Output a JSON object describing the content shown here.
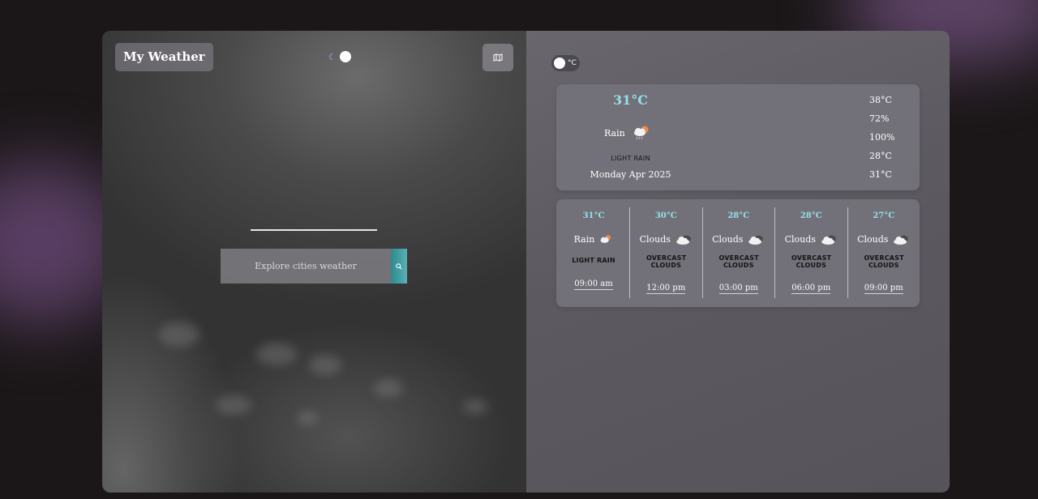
{
  "header": {
    "brand": "My Weather"
  },
  "search": {
    "placeholder": "Explore cities weather"
  },
  "unit_toggle": {
    "label": "°C"
  },
  "current": {
    "temp": "31°C",
    "condition": "Rain",
    "description": "LIGHT RAIN",
    "date": "Monday Apr 2025",
    "stats": [
      "38°C",
      "72%",
      "100%",
      "28°C",
      "31°C"
    ]
  },
  "forecast": [
    {
      "temp": "31°C",
      "condition": "Rain",
      "description": "LIGHT RAIN",
      "time": "09:00 am",
      "icon": "rain-sun-icon"
    },
    {
      "temp": "30°C",
      "condition": "Clouds",
      "description": "OVERCAST CLOUDS",
      "time": "12:00 pm",
      "icon": "cloud-icon"
    },
    {
      "temp": "28°C",
      "condition": "Clouds",
      "description": "OVERCAST CLOUDS",
      "time": "03:00 pm",
      "icon": "cloud-icon"
    },
    {
      "temp": "28°C",
      "condition": "Clouds",
      "description": "OVERCAST CLOUDS",
      "time": "06:00 pm",
      "icon": "cloud-icon"
    },
    {
      "temp": "27°C",
      "condition": "Clouds",
      "description": "OVERCAST CLOUDS",
      "time": "09:00 pm",
      "icon": "cloud-icon"
    }
  ],
  "icons": {
    "theme": "moon-icon",
    "map": "map-icon",
    "search": "search-icon"
  },
  "colors": {
    "accent_temp": "#95e0e6",
    "search_button": "#3a9ea3"
  }
}
